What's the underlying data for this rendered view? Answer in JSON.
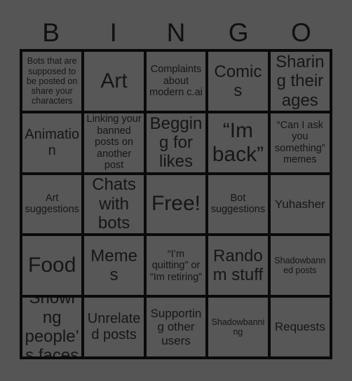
{
  "card": {
    "header_letters": [
      "B",
      "I",
      "N",
      "G",
      "O"
    ],
    "colors": {
      "background": "#555555",
      "cell_fill": "#575757",
      "grid_line": "#0a0a0a",
      "text": "#161616"
    },
    "rows": [
      [
        {
          "text": "Bots that are supposed to be posted on share your characters",
          "size": "xs"
        },
        {
          "text": "Art",
          "size": "xxl"
        },
        {
          "text": "Complaints about modern c.ai",
          "size": "s"
        },
        {
          "text": "Comics",
          "size": "xl"
        },
        {
          "text": "Sharing their ages",
          "size": "xl"
        }
      ],
      [
        {
          "text": "Animation",
          "size": "l"
        },
        {
          "text": "Linking your banned posts on another post",
          "size": "s"
        },
        {
          "text": "Begging for likes",
          "size": "xl"
        },
        {
          "text": "“Im back”",
          "size": "xxl"
        },
        {
          "text": "“Can I ask you something” memes",
          "size": "s"
        }
      ],
      [
        {
          "text": "Art suggestions",
          "size": "s"
        },
        {
          "text": "Chats with bots",
          "size": "xl"
        },
        {
          "text": "Free!",
          "size": "xxl"
        },
        {
          "text": "Bot suggestions",
          "size": "s"
        },
        {
          "text": "Yuhasher",
          "size": "m"
        }
      ],
      [
        {
          "text": "Food",
          "size": "xxl"
        },
        {
          "text": "Memes",
          "size": "xl"
        },
        {
          "text": "“I’m quitting” or “Im retiring”",
          "size": "s"
        },
        {
          "text": "Random stuff",
          "size": "xl"
        },
        {
          "text": "Shadowbanned posts",
          "size": "xs"
        }
      ],
      [
        {
          "text": "Showing people’s faces",
          "size": "xl"
        },
        {
          "text": "Unrelated posts",
          "size": "l"
        },
        {
          "text": "Supporting other users",
          "size": "m"
        },
        {
          "text": "Shadowbanning",
          "size": "xs"
        },
        {
          "text": "Requests",
          "size": "m"
        }
      ]
    ]
  }
}
